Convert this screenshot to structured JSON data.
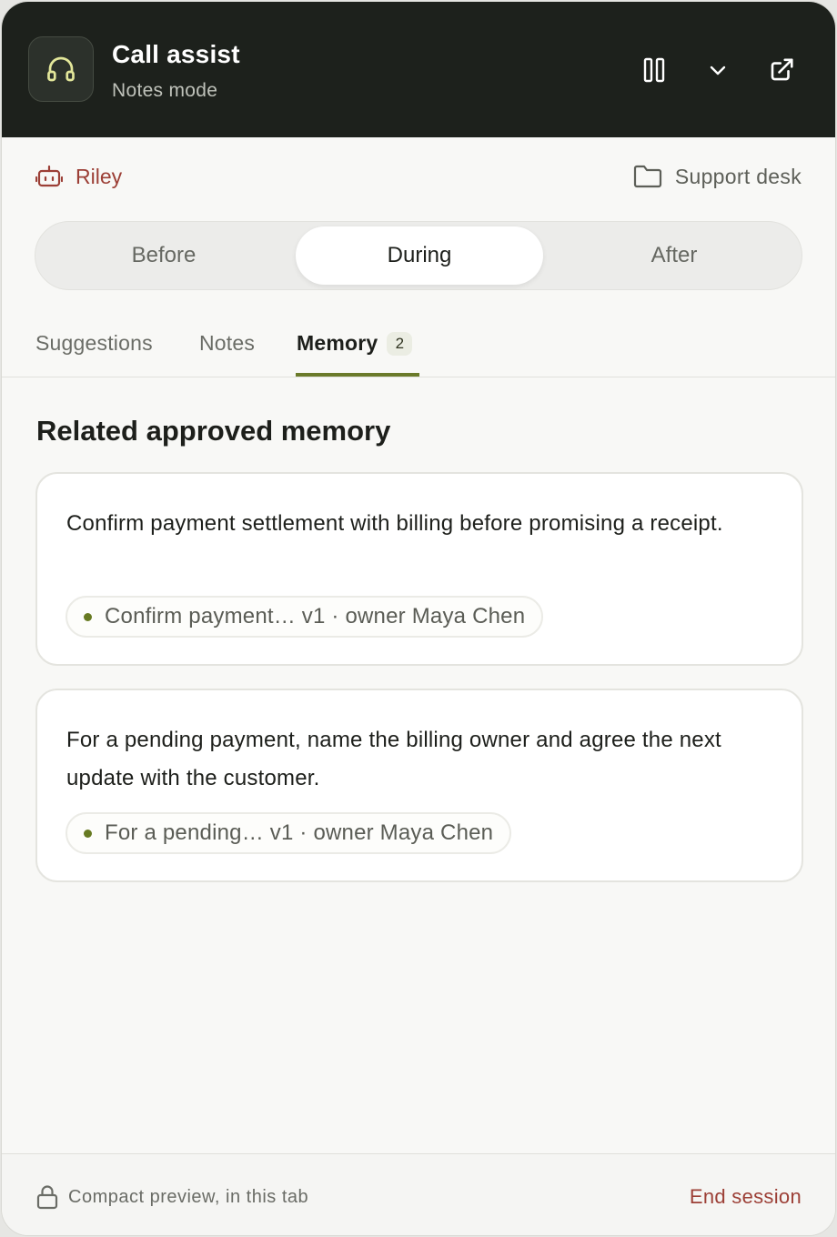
{
  "header": {
    "title": "Call assist",
    "subtitle": "Notes mode",
    "icon": "headphones-icon",
    "actions": [
      {
        "name": "pause-button",
        "icon": "pause-icon"
      },
      {
        "name": "collapse-button",
        "icon": "chevron-down-icon"
      },
      {
        "name": "pop-out-button",
        "icon": "external-link-icon"
      }
    ]
  },
  "context": {
    "agent_name": "Riley",
    "agent_icon": "bot-icon",
    "desk_name": "Support desk",
    "desk_icon": "folder-icon"
  },
  "phases": {
    "items": [
      "Before",
      "During",
      "After"
    ],
    "active": "During"
  },
  "tabs": {
    "items": [
      {
        "label": "Suggestions"
      },
      {
        "label": "Notes"
      },
      {
        "label": "Memory",
        "badge": "2"
      }
    ],
    "active": "Memory"
  },
  "memory": {
    "section_title": "Related approved memory",
    "cards": [
      {
        "text": "Confirm payment settlement with billing before promising a receipt.",
        "chip": "Confirm payment… v1 · owner Maya Chen"
      },
      {
        "text": "For a pending payment, name the billing owner and agree the next update with the customer.",
        "chip": "For a pending… v1 · owner Maya Chen"
      }
    ]
  },
  "footer": {
    "status": "Compact preview, in this tab",
    "end_label": "End session",
    "lock_icon": "lock-icon"
  },
  "colors": {
    "header_bg": "#1d211c",
    "accent_red": "#9c3f36",
    "accent_olive": "#6a7a2a",
    "icon_yellow": "#e3e79a"
  }
}
